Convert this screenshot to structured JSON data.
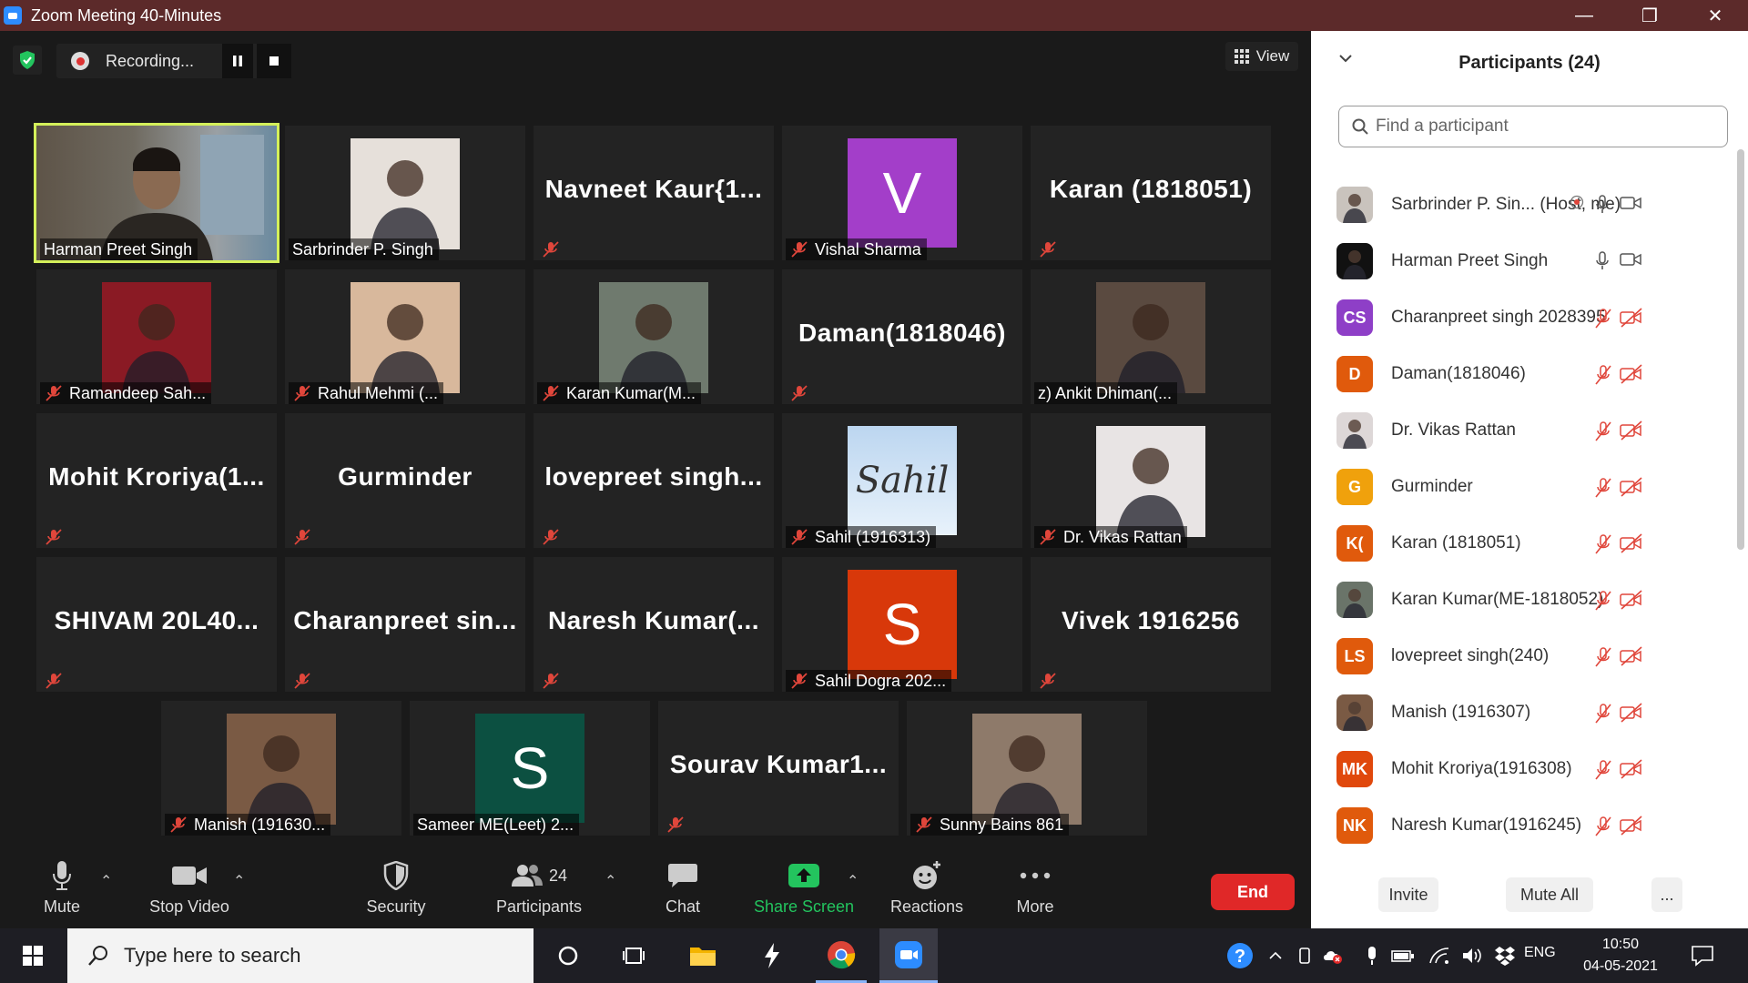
{
  "window": {
    "title": "Zoom Meeting 40-Minutes",
    "minimize": "—",
    "restore": "❐",
    "close": "✕"
  },
  "recording": {
    "label": "Recording..."
  },
  "view": {
    "label": "View"
  },
  "tiles": [
    {
      "id": "t1",
      "label": "Harman Preet Singh",
      "kind": "photo",
      "muted": false,
      "active": true,
      "photo": "#6b6357"
    },
    {
      "id": "t2",
      "label": "Sarbrinder P. Singh",
      "kind": "photo",
      "muted": false,
      "photo": "#e6e0da"
    },
    {
      "id": "t3",
      "label": "",
      "kind": "name",
      "name": "Navneet  Kaur{1...",
      "muted": true
    },
    {
      "id": "t4",
      "label": "Vishal Sharma",
      "kind": "avatar",
      "letter": "V",
      "bg": "#a33ec9",
      "muted": true
    },
    {
      "id": "t5",
      "label": "",
      "kind": "name",
      "name": "Karan (1818051)",
      "muted": true
    },
    {
      "id": "t6",
      "label": "Ramandeep Sah...",
      "kind": "photo",
      "muted": true,
      "photo": "#8a1a24"
    },
    {
      "id": "t7",
      "label": "Rahul Mehmi (...",
      "kind": "photo",
      "muted": true,
      "photo": "#d8b89c"
    },
    {
      "id": "t8",
      "label": "Karan Kumar(M...",
      "kind": "photo",
      "muted": true,
      "photo": "#6f7a6e"
    },
    {
      "id": "t9",
      "label": "",
      "kind": "name",
      "name": "Daman(1818046)",
      "muted": true
    },
    {
      "id": "t10",
      "label": "z)   Ankit Dhiman(...",
      "kind": "photo",
      "muted": false,
      "photo": "#5a4a40"
    },
    {
      "id": "t11",
      "label": "",
      "kind": "name",
      "name": "Mohit  Kroriya(1...",
      "muted": true
    },
    {
      "id": "t12",
      "label": "",
      "kind": "name",
      "name": "Gurminder",
      "muted": true
    },
    {
      "id": "t13",
      "label": "",
      "kind": "name",
      "name": "lovepreet  singh...",
      "muted": true
    },
    {
      "id": "t14",
      "label": "Sahil (1916313)",
      "kind": "sahil",
      "muted": true,
      "text": "Sahil"
    },
    {
      "id": "t15",
      "label": "Dr. Vikas Rattan",
      "kind": "photo",
      "muted": true,
      "photo": "#e8e4e4"
    },
    {
      "id": "t16",
      "label": "",
      "kind": "name",
      "name": "SHIVAM  20L40...",
      "muted": true
    },
    {
      "id": "t17",
      "label": "",
      "kind": "name",
      "name": "Charanpreet  sin...",
      "muted": true
    },
    {
      "id": "t18",
      "label": "",
      "kind": "name",
      "name": "Naresh  Kumar(...",
      "muted": true
    },
    {
      "id": "t19",
      "label": "Sahil Dogra 202...",
      "kind": "avatar",
      "letter": "S",
      "bg": "#d8380a",
      "muted": true
    },
    {
      "id": "t20",
      "label": "",
      "kind": "name",
      "name": "Vivek 1916256",
      "muted": true
    },
    {
      "id": "t21",
      "label": "Manish (191630...",
      "kind": "photo",
      "muted": true,
      "photo": "#7a5a44"
    },
    {
      "id": "t22",
      "label": "Sameer ME(Leet) 2...",
      "kind": "avatar",
      "letter": "S",
      "bg": "#0c5041",
      "muted": false
    },
    {
      "id": "t23",
      "label": "",
      "kind": "name",
      "name": "Sourav  Kumar1...",
      "muted": true
    },
    {
      "id": "t24",
      "label": "Sunny Bains 861",
      "kind": "photo",
      "muted": true,
      "photo": "#8e7a6a"
    }
  ],
  "toolbar": {
    "mute": "Mute",
    "stop_video": "Stop Video",
    "security": "Security",
    "participants": "Participants",
    "participants_count": "24",
    "chat": "Chat",
    "share_screen": "Share Screen",
    "reactions": "Reactions",
    "more": "More",
    "end": "End"
  },
  "panel": {
    "title": "Participants (24)",
    "search_placeholder": "Find a participant",
    "invite": "Invite",
    "mute_all": "Mute All",
    "more": "...",
    "participants": [
      {
        "name": "Sarbrinder P. Sin...  (Host, me)",
        "initials": "",
        "bg": "#c9c3bd",
        "mic": "on",
        "video": "on",
        "rec": true
      },
      {
        "name": "Harman Preet Singh",
        "initials": "",
        "bg": "#111111",
        "mic": "on",
        "video": "on"
      },
      {
        "name": "Charanpreet singh 2028395",
        "initials": "CS",
        "bg": "#8e3fc7",
        "mic": "off",
        "video": "off"
      },
      {
        "name": "Daman(1818046)",
        "initials": "D",
        "bg": "#e05a0c",
        "mic": "off",
        "video": "off"
      },
      {
        "name": "Dr. Vikas Rattan",
        "initials": "",
        "bg": "#ddd7d7",
        "mic": "off",
        "video": "off"
      },
      {
        "name": "Gurminder",
        "initials": "G",
        "bg": "#f0a10c",
        "mic": "off",
        "video": "off"
      },
      {
        "name": "Karan (1818051)",
        "initials": "K(",
        "bg": "#e05a0c",
        "mic": "off",
        "video": "off"
      },
      {
        "name": "Karan Kumar(ME-1818052)",
        "initials": "",
        "bg": "#6a7469",
        "mic": "off",
        "video": "off"
      },
      {
        "name": "lovepreet singh(240)",
        "initials": "LS",
        "bg": "#e05a0c",
        "mic": "off",
        "video": "off"
      },
      {
        "name": "Manish (1916307)",
        "initials": "",
        "bg": "#7a5a44",
        "mic": "off",
        "video": "off"
      },
      {
        "name": "Mohit Kroriya(1916308)",
        "initials": "MK",
        "bg": "#e0480c",
        "mic": "off",
        "video": "off"
      },
      {
        "name": "Naresh Kumar(1916245)",
        "initials": "NK",
        "bg": "#e05a0c",
        "mic": "off",
        "video": "off"
      }
    ]
  },
  "taskbar": {
    "search_placeholder": "Type here to search",
    "lang": "ENG",
    "time": "10:50",
    "date": "04-05-2021"
  },
  "colors": {
    "accent_green": "#23c45e",
    "end_red": "#e02828",
    "active_outline": "#d4f05a",
    "mute_red": "#e0463b"
  }
}
